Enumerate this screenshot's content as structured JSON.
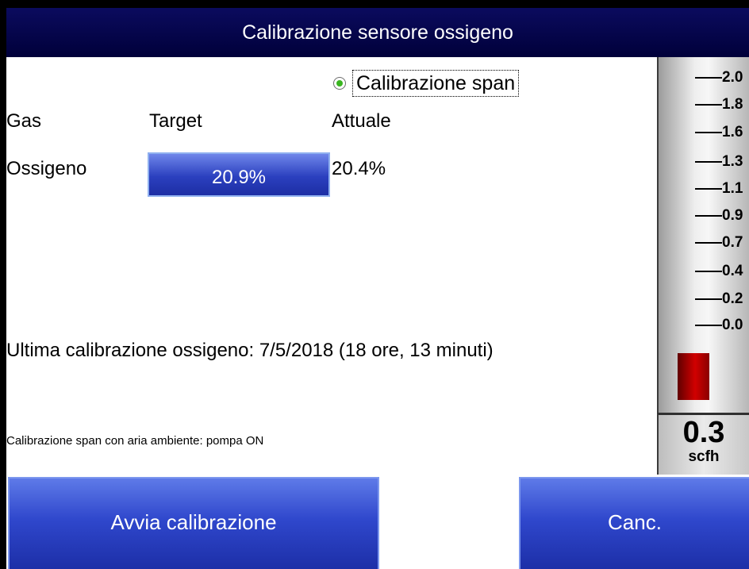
{
  "window": {
    "title": "Calibrazione sensore ossigeno"
  },
  "mode": {
    "label": "Calibrazione span",
    "selected": true
  },
  "table": {
    "headers": {
      "gas": "Gas",
      "target": "Target",
      "actual": "Attuale"
    },
    "rows": [
      {
        "gas": "Ossigeno",
        "target": "20.9%",
        "actual": "20.4%"
      }
    ]
  },
  "last_calibration": "Ultima calibrazione ossigeno: 7/5/2018 (18 ore, 13 minuti)",
  "note": "Calibrazione span con aria ambiente: pompa ON",
  "actions": {
    "start_label": "Avvia calibrazione",
    "cancel_label": "Canc."
  },
  "flowmeter": {
    "ticks": [
      "2.0",
      "1.8",
      "1.6",
      "1.3",
      "1.1",
      "0.9",
      "0.7",
      "0.4",
      "0.2",
      "0.0"
    ],
    "value": "0.3",
    "unit": "scfh",
    "bar_color": "#cc0000"
  },
  "colors": {
    "title_bar": "#03034a",
    "button": "#2f47cc",
    "radio_selected": "#3ab520"
  }
}
